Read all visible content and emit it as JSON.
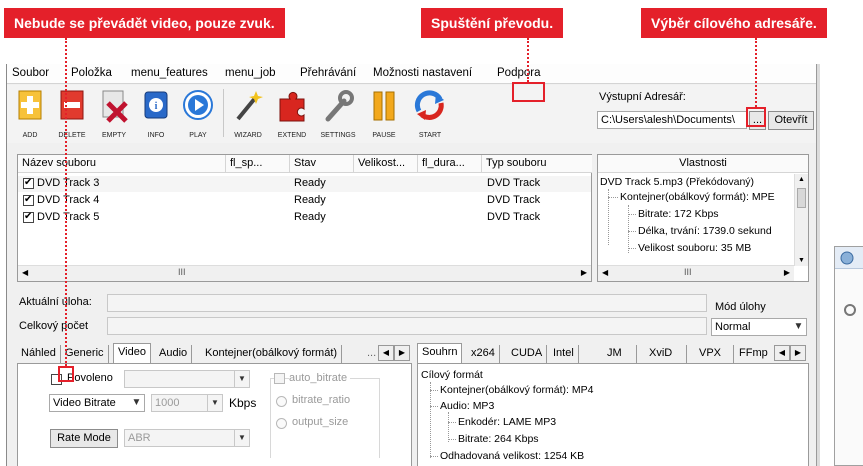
{
  "callouts": {
    "left": "Nebude se převádět video, pouze zvuk.",
    "middle": "Spuštění převodu.",
    "right": "Výběr cílového adresáře."
  },
  "menu": [
    "Soubor",
    "Položka",
    "menu_features",
    "menu_job",
    "Přehrávání",
    "Možnosti nastavení",
    "Podpora"
  ],
  "toolbar": [
    {
      "label": "ADD",
      "icon": "add-icon",
      "color": "#f2a81c"
    },
    {
      "label": "DELETE",
      "icon": "delete-icon",
      "color": "#d8261f"
    },
    {
      "label": "EMPTY",
      "icon": "empty-icon",
      "color": "#c0122f"
    },
    {
      "label": "INFO",
      "icon": "info-icon",
      "color": "#2a69c8"
    },
    {
      "label": "PLAY",
      "icon": "play-icon",
      "color": "#2a78d8"
    },
    {
      "label": "WIZARD",
      "icon": "wizard-icon",
      "color": "#5b5b5b"
    },
    {
      "label": "EXTEND",
      "icon": "extend-icon",
      "color": "#d8261f"
    },
    {
      "label": "SETTINGS",
      "icon": "settings-icon",
      "color": "#777777"
    },
    {
      "label": "PAUSE",
      "icon": "pause-icon",
      "color": "#f2a81c"
    },
    {
      "label": "START",
      "icon": "start-icon",
      "color": "#2a78d8"
    }
  ],
  "output": {
    "label": "Výstupní Adresář:",
    "path": "C:\\Users\\alesh\\Documents\\",
    "browse": "...",
    "open": "Otevřít"
  },
  "files": {
    "columns": [
      "Název souboru",
      "fl_sp...",
      "Stav",
      "Velikost...",
      "fl_dura...",
      "Typ souboru"
    ],
    "rows": [
      {
        "name": "DVD Track 3",
        "status": "Ready",
        "type": "DVD Track"
      },
      {
        "name": "DVD Track 4",
        "status": "Ready",
        "type": "DVD Track"
      },
      {
        "name": "DVD Track 5",
        "status": "Ready",
        "type": "DVD Track"
      }
    ],
    "scroll_glyph": "III"
  },
  "properties": {
    "title": "Vlastnosti",
    "lines": [
      "DVD Track 5.mp3 (Překódovaný)",
      "Kontejner(obálkový formát): MPE",
      "Bitrate: 172 Kbps",
      "Délka, trvání: 1739.0 sekund",
      "Velikost souboru: 35 MB"
    ]
  },
  "status": {
    "current_task": "Aktuální úloha:",
    "total_count": "Celkový počet úloh:",
    "mode_label": "Mód úlohy",
    "mode_value": "Normal"
  },
  "left_tabs": [
    "Náhled",
    "Generic",
    "Video",
    "Audio",
    "Kontejner(obálkový formát)"
  ],
  "video": {
    "enabled_label": "Povoleno",
    "auto_bitrate": "auto_bitrate",
    "bitrate_ratio": "bitrate_ratio",
    "output_size": "output_size",
    "bitrate_mode": "Video Bitrate",
    "bitrate_value": "1000",
    "unit": "Kbps",
    "rate_mode_button": "Rate Mode",
    "rate_mode_value": "ABR"
  },
  "right_tabs": [
    "Souhrn",
    "x264",
    "CUDA",
    "Intel",
    "JM",
    "XviD",
    "VPX",
    "FFmp"
  ],
  "summary": {
    "lines": [
      "Cílový formát",
      "Kontejner(obálkový formát): MP4",
      "Audio: MP3",
      "Enkodér: LAME MP3",
      "Bitrate: 264 Kbps",
      "Odhadovaná velikost: 1254 KB"
    ]
  }
}
